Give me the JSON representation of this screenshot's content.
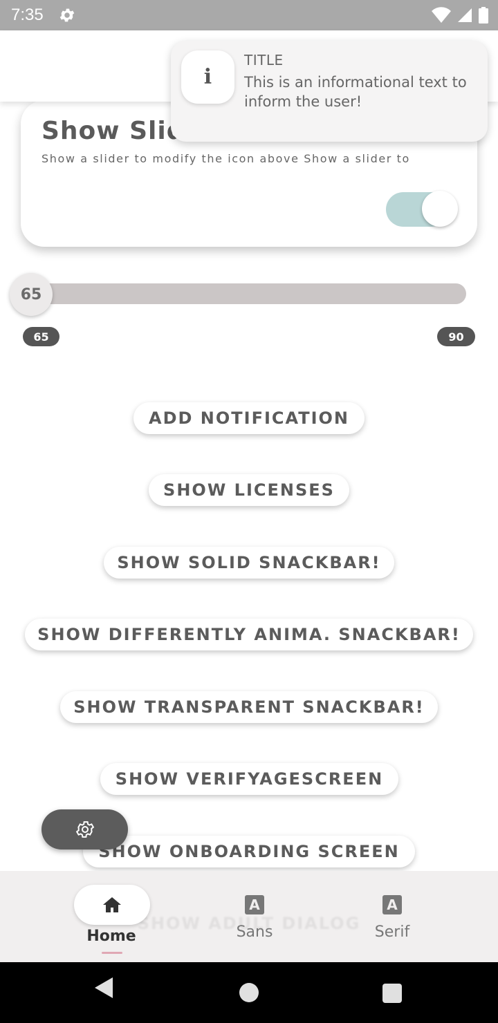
{
  "status_bar": {
    "time": "7:35",
    "icons": [
      "settings-icon",
      "wifi-icon",
      "signal-icon",
      "battery-icon"
    ]
  },
  "card": {
    "title": "Show Slid",
    "description": "Show a slider to modify the icon above Show a slider to",
    "toggle_on": true
  },
  "slider": {
    "value": "65",
    "min_label": "65",
    "max_label": "90"
  },
  "buttons": {
    "add_notification": "ADD NOTIFICATION",
    "show_licenses": "SHOW LICENSES",
    "show_solid_snackbar": "SHOW SOLID SNACKBAR!",
    "show_animated_snackbar": "SHOW DIFFERENTLY ANIMA. SNACKBAR!",
    "show_transparent_snackbar": "SHOW TRANSPARENT SNACKBAR!",
    "show_verify_age": "SHOW VERIFYAGESCREEN",
    "show_onboarding": "SHOW ONBOARDING SCREEN"
  },
  "bottom_nav": {
    "ghost_text": "SHOW ADULT DIALOG",
    "items": [
      {
        "label": "Home",
        "icon": "home-icon",
        "selected": true
      },
      {
        "label": "Sans",
        "icon": "font-a-icon",
        "glyph": "A"
      },
      {
        "label": "Serif",
        "icon": "font-a-icon",
        "glyph": "A"
      }
    ]
  },
  "toast": {
    "icon_glyph": "i",
    "title": "TITLE",
    "message": "This is an informational text to inform the user!"
  },
  "colors": {
    "status_bar": "#a9a9a9",
    "toggle_track": "#b9d6d6",
    "slider_track": "#cbc6c6",
    "badge": "#555555",
    "fab": "#5c5c5c",
    "nav_bg": "#f1efef",
    "home_underline": "#e0a8b4"
  }
}
